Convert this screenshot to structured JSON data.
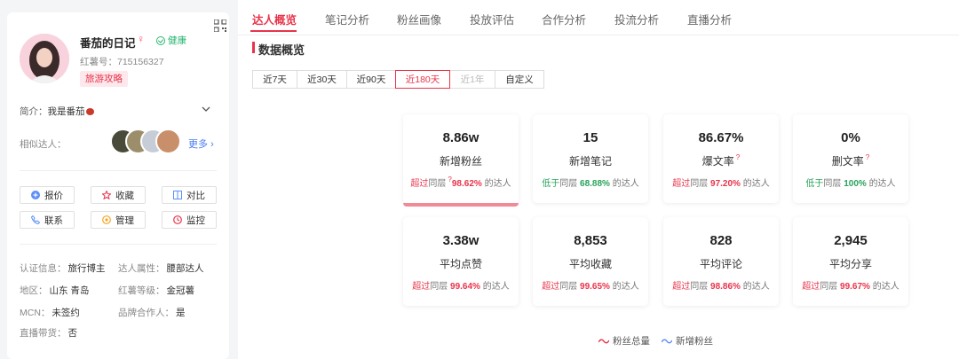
{
  "profile": {
    "nickname": "番茄的日记",
    "gender_symbol": "♀",
    "health_label": "健康",
    "red_id_label": "红薯号：",
    "red_id": "715156327",
    "tag": "旅游攻略",
    "intro_label": "简介：",
    "intro_text": "我是番茄",
    "similar_label": "相似达人：",
    "more_label": "更多"
  },
  "actions": [
    {
      "label": "报价",
      "icon": "price-icon"
    },
    {
      "label": "收藏",
      "icon": "star-icon"
    },
    {
      "label": "对比",
      "icon": "compare-icon"
    },
    {
      "label": "联系",
      "icon": "phone-icon"
    },
    {
      "label": "管理",
      "icon": "manage-icon"
    },
    {
      "label": "监控",
      "icon": "monitor-icon"
    }
  ],
  "info": {
    "cert_label": "认证信息：",
    "cert": "旅行博主",
    "attr_label": "达人属性：",
    "attr": "腰部达人",
    "region_label": "地区：",
    "region": "山东 青岛",
    "level_label": "红薯等级：",
    "level": "金冠薯",
    "mcn_label": "MCN：",
    "mcn": "未签约",
    "brand_label": "品牌合作人：",
    "brand": "是",
    "live_label": "直播带货：",
    "live": "否"
  },
  "tabs": [
    "达人概览",
    "笔记分析",
    "粉丝画像",
    "投放评估",
    "合作分析",
    "投流分析",
    "直播分析"
  ],
  "section_title": "数据概览",
  "ranges": [
    "近7天",
    "近30天",
    "近90天",
    "近180天",
    "近1年",
    "自定义"
  ],
  "cards": [
    {
      "value": "8.86w",
      "label": "新增粉丝",
      "cmp_word": "超过",
      "cmp_mid": "同层",
      "pct": "98.62%",
      "tail": "的达人",
      "dir": "over",
      "q": "?"
    },
    {
      "value": "15",
      "label": "新增笔记",
      "cmp_word": "低于",
      "cmp_mid": "同层",
      "pct": "68.88%",
      "tail": "的达人",
      "dir": "low",
      "q": ""
    },
    {
      "value": "86.67%",
      "label": "爆文率",
      "cmp_word": "超过",
      "cmp_mid": "同层",
      "pct": "97.20%",
      "tail": "的达人",
      "dir": "over",
      "q": "?"
    },
    {
      "value": "0%",
      "label": "删文率",
      "cmp_word": "低于",
      "cmp_mid": "同层",
      "pct": "100%",
      "tail": "的达人",
      "dir": "low",
      "q": "?"
    },
    {
      "value": "3.38w",
      "label": "平均点赞",
      "cmp_word": "超过",
      "cmp_mid": "同层",
      "pct": "99.64%",
      "tail": "的达人",
      "dir": "over",
      "q": ""
    },
    {
      "value": "8,853",
      "label": "平均收藏",
      "cmp_word": "超过",
      "cmp_mid": "同层",
      "pct": "99.65%",
      "tail": "的达人",
      "dir": "over",
      "q": ""
    },
    {
      "value": "828",
      "label": "平均评论",
      "cmp_word": "超过",
      "cmp_mid": "同层",
      "pct": "98.86%",
      "tail": "的达人",
      "dir": "over",
      "q": ""
    },
    {
      "value": "2,945",
      "label": "平均分享",
      "cmp_word": "超过",
      "cmp_mid": "同层",
      "pct": "99.67%",
      "tail": "的达人",
      "dir": "over",
      "q": ""
    }
  ],
  "legend": [
    "粉丝总量",
    "新增粉丝"
  ],
  "colors": {
    "accent": "#e8344a",
    "lower": "#27a35a",
    "legend_blue": "#5b8ff9"
  }
}
